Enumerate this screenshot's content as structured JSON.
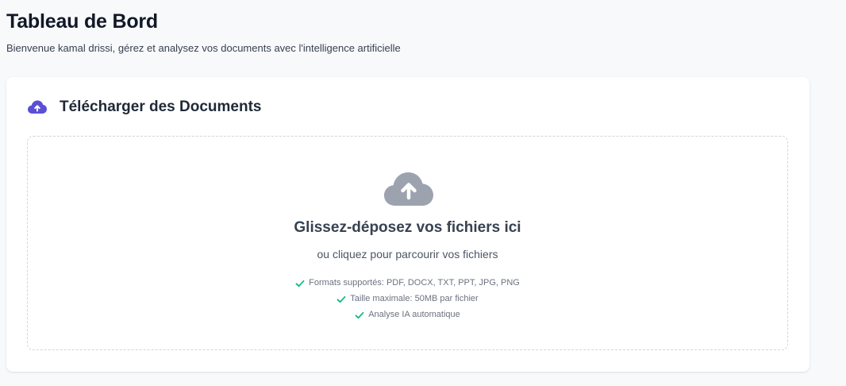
{
  "header": {
    "title": "Tableau de Bord",
    "subtitle": "Bienvenue kamal drissi, gérez et analysez vos documents avec l'intelligence artificielle"
  },
  "upload_card": {
    "title": "Télécharger des Documents",
    "title_icon": "cloud-upload-icon",
    "dropzone": {
      "icon": "cloud-upload-icon",
      "title": "Glissez-déposez vos fichiers ici",
      "subtitle": "ou cliquez pour parcourir vos fichiers",
      "features": [
        "Formats supportés: PDF, DOCX, TXT, PPT, JPG, PNG",
        "Taille maximale: 50MB par fichier",
        "Analyse IA automatique"
      ]
    }
  },
  "colors": {
    "accent": "#5b4fd6",
    "cloud_gray": "#9ca3af",
    "check_green": "#10b981",
    "page_bg": "#f8f9fb"
  }
}
